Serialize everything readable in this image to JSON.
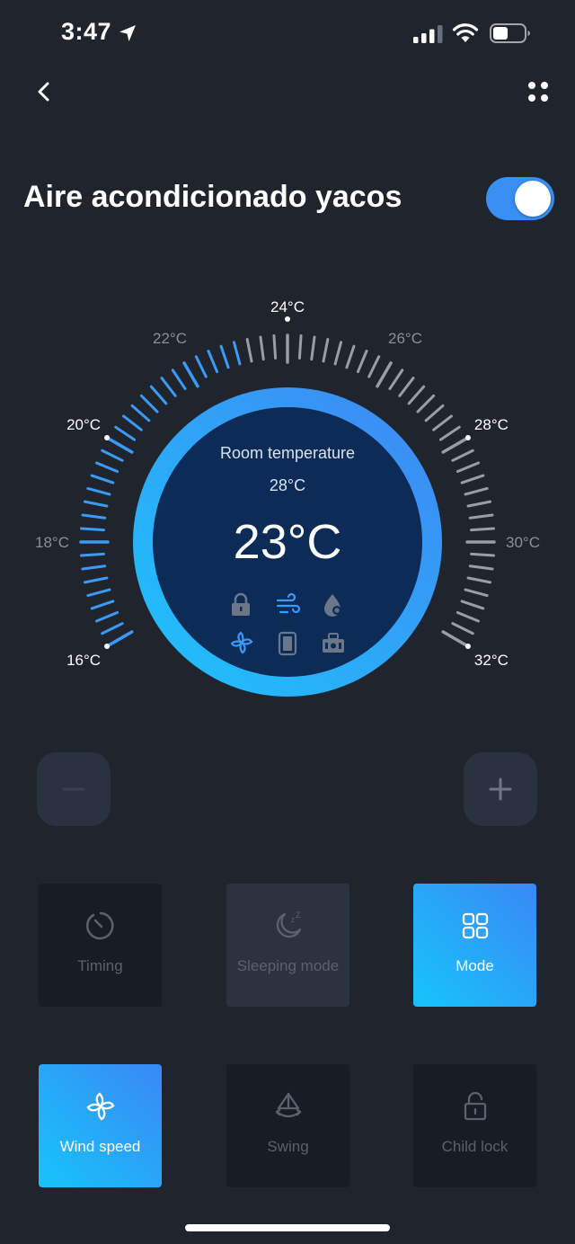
{
  "status_bar": {
    "time": "3:47"
  },
  "header": {
    "title": "Aire acondicionado yacos",
    "power_on": true
  },
  "dial": {
    "min_temp": 16,
    "max_temp": 32,
    "set_temp_value": 23,
    "tick_labels": [
      "16°C",
      "18°C",
      "20°C",
      "22°C",
      "24°C",
      "26°C",
      "28°C",
      "30°C",
      "32°C"
    ],
    "room_label": "Room temperature",
    "room_value": "28°C",
    "set_temp": "23°C",
    "active_color": "#3a9af5",
    "inactive_color": "#9a9da3"
  },
  "status_icons": [
    "lock-icon",
    "wind-icon",
    "dry-drop-icon",
    "fan-icon",
    "vent-icon",
    "heater-icon"
  ],
  "controls": {
    "minus": "−",
    "plus": "+"
  },
  "tiles": {
    "timing": "Timing",
    "sleeping": "Sleeping mode",
    "mode": "Mode",
    "wind_speed": "Wind speed",
    "swing": "Swing",
    "child_lock": "Child lock"
  },
  "colors": {
    "accent": "#3a8ff2",
    "background": "#20242d",
    "dial_inner": "#0c2b57"
  }
}
